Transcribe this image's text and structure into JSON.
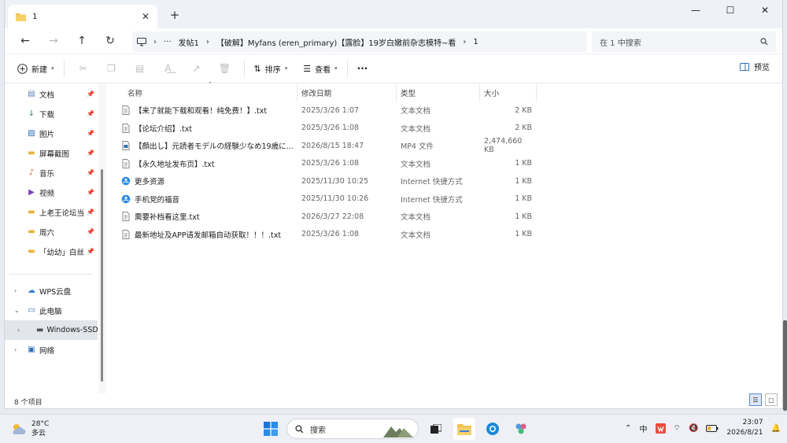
{
  "window": {
    "tab_title": "1",
    "close_tab": "✕",
    "new_tab": "+",
    "minimize": "—",
    "maximize": "☐",
    "close": "✕"
  },
  "nav": {
    "back": "←",
    "forward": "→",
    "up": "↑",
    "refresh": "↻",
    "breadcrumb": [
      "发帖1",
      "【破解】Myfans (eren_primary)【露脸】19岁白嫩前杂志模特~看",
      "1"
    ],
    "ellipsis": "···",
    "search_placeholder": "在 1 中搜索"
  },
  "toolbar": {
    "new_label": "新建",
    "sort_label": "排序",
    "view_label": "查看",
    "more": "···",
    "preview_label": "预览"
  },
  "sidebar": {
    "quick": [
      {
        "label": "文档",
        "icon": "document-icon",
        "glyph": "▤",
        "color": "#5a7fb5"
      },
      {
        "label": "下载",
        "icon": "download-icon",
        "glyph": "↓",
        "color": "#1e8f4e"
      },
      {
        "label": "图片",
        "icon": "picture-icon",
        "glyph": "▨",
        "color": "#2d6fb8"
      },
      {
        "label": "屏幕截图",
        "icon": "folder-icon",
        "glyph": "▬",
        "color": "#e8b23a"
      },
      {
        "label": "音乐",
        "icon": "music-icon",
        "glyph": "♪",
        "color": "#e35a3a"
      },
      {
        "label": "视频",
        "icon": "video-icon",
        "glyph": "▶",
        "color": "#7a3fb8"
      },
      {
        "label": "上老王论坛当",
        "icon": "folder-icon",
        "glyph": "▬",
        "color": "#e8b23a"
      },
      {
        "label": "周六",
        "icon": "folder-icon",
        "glyph": "▬",
        "color": "#e8b23a"
      },
      {
        "label": "「幼幼」白丝",
        "icon": "folder-icon",
        "glyph": "▬",
        "color": "#e8b23a"
      }
    ],
    "pin_glyph": "📌",
    "tree": [
      {
        "label": "WPS云盘",
        "icon": "cloud-icon",
        "glyph": "☁",
        "color": "#2d7ed8",
        "chev": "›"
      },
      {
        "label": "此电脑",
        "icon": "computer-icon",
        "glyph": "▭",
        "color": "#2d6fb8",
        "chev": "⌄"
      },
      {
        "label": "Windows-SSD",
        "icon": "drive-icon",
        "glyph": "▬",
        "color": "#555",
        "chev": "›"
      },
      {
        "label": "网络",
        "icon": "network-icon",
        "glyph": "▣",
        "color": "#2d6fb8",
        "chev": "›"
      }
    ]
  },
  "columns": {
    "name": "名称",
    "date": "修改日期",
    "type": "类型",
    "size": "大小"
  },
  "files": [
    {
      "name": "【来了就能下载和观看！纯免费！】.txt",
      "date": "2025/3/26 1:07",
      "type": "文本文档",
      "size": "2 KB",
      "icon": "txt"
    },
    {
      "name": "【论坛介绍】.txt",
      "date": "2025/3/26 1:08",
      "type": "文本文档",
      "size": "2 KB",
      "icon": "txt"
    },
    {
      "name": "【顔出し】元読者モデルの経験少なめ19歳に...",
      "date": "2026/8/15 18:47",
      "type": "MP4 文件",
      "size": "2,474,660 KB",
      "icon": "mp4"
    },
    {
      "name": "【永久地址发布页】.txt",
      "date": "2025/3/26 1:08",
      "type": "文本文档",
      "size": "1 KB",
      "icon": "txt"
    },
    {
      "name": "更多资源",
      "date": "2025/11/30 10:25",
      "type": "Internet 快捷方式",
      "size": "1 KB",
      "icon": "url"
    },
    {
      "name": "手机党的福音",
      "date": "2025/11/30 10:26",
      "type": "Internet 快捷方式",
      "size": "1 KB",
      "icon": "url"
    },
    {
      "name": "需要补档看这里.txt",
      "date": "2026/3/27 22:08",
      "type": "文本文档",
      "size": "1 KB",
      "icon": "txt"
    },
    {
      "name": "最新地址及APP请发邮箱自动获取！！！.txt",
      "date": "2025/3/26 1:08",
      "type": "文本文档",
      "size": "1 KB",
      "icon": "txt"
    }
  ],
  "status": {
    "count": "8 个项目"
  },
  "taskbar": {
    "temp": "28°C",
    "weather": "多云",
    "search_label": "搜索",
    "ime": "中",
    "time": "23:07",
    "date": "2026/8/21"
  }
}
